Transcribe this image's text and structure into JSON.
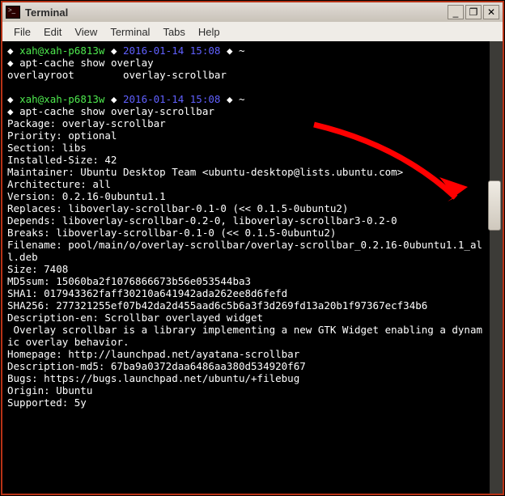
{
  "window": {
    "title": "Terminal"
  },
  "menu": {
    "file": "File",
    "edit": "Edit",
    "view": "View",
    "terminal": "Terminal",
    "tabs": "Tabs",
    "help": "Help"
  },
  "btn": {
    "min": "_",
    "max": "❐",
    "close": "✕"
  },
  "p1": {
    "diamond": "◆ ",
    "user": "xah@xah-p6813w",
    "sep": " ◆ ",
    "ts": "2016-01-14 15:08",
    "tail": " ◆ ~",
    "cmdPrefix": "◆ ",
    "cmd": "apt-cache show overlay",
    "out": "overlayroot        overlay-scrollbar"
  },
  "p2": {
    "diamond": "◆ ",
    "user": "xah@xah-p6813w",
    "sep": " ◆ ",
    "ts": "2016-01-14 15:08",
    "tail": " ◆ ~",
    "cmdPrefix": "◆ ",
    "cmd": "apt-cache show overlay-scrollbar"
  },
  "pkg": {
    "l1": "Package: overlay-scrollbar",
    "l2": "Priority: optional",
    "l3": "Section: libs",
    "l4": "Installed-Size: 42",
    "l5": "Maintainer: Ubuntu Desktop Team <ubuntu-desktop@lists.ubuntu.com>",
    "l6": "Architecture: all",
    "l7": "Version: 0.2.16-0ubuntu1.1",
    "l8": "Replaces: liboverlay-scrollbar-0.1-0 (<< 0.1.5-0ubuntu2)",
    "l9": "Depends: liboverlay-scrollbar-0.2-0, liboverlay-scrollbar3-0.2-0",
    "l10": "Breaks: liboverlay-scrollbar-0.1-0 (<< 0.1.5-0ubuntu2)",
    "l11": "Filename: pool/main/o/overlay-scrollbar/overlay-scrollbar_0.2.16-0ubuntu1.1_all.deb",
    "l12": "Size: 7408",
    "l13": "MD5sum: 15060ba2f1076866673b56e053544ba3",
    "l14": "SHA1: 017943362faff30210a641942ada262ee8d6fefd",
    "l15": "SHA256: 277321255ef07b42da2d455aad6c5b6a3f3d269fd13a20b1f97367ecf34b6",
    "l16": "Description-en: Scrollbar overlayed widget",
    "l17": " Overlay scrollbar is a library implementing a new GTK Widget enabling a dynamic overlay behavior.",
    "l18": "Homepage: http://launchpad.net/ayatana-scrollbar",
    "l19": "Description-md5: 67ba9a0372daa6486aa380d534920f67",
    "l20": "Bugs: https://bugs.launchpad.net/ubuntu/+filebug",
    "l21": "Origin: Ubuntu",
    "l22": "Supported: 5y"
  },
  "colors": {
    "accent": "#b73216",
    "promptUser": "#4ee94e",
    "promptTime": "#6060ff",
    "annotation": "#ff0000"
  }
}
